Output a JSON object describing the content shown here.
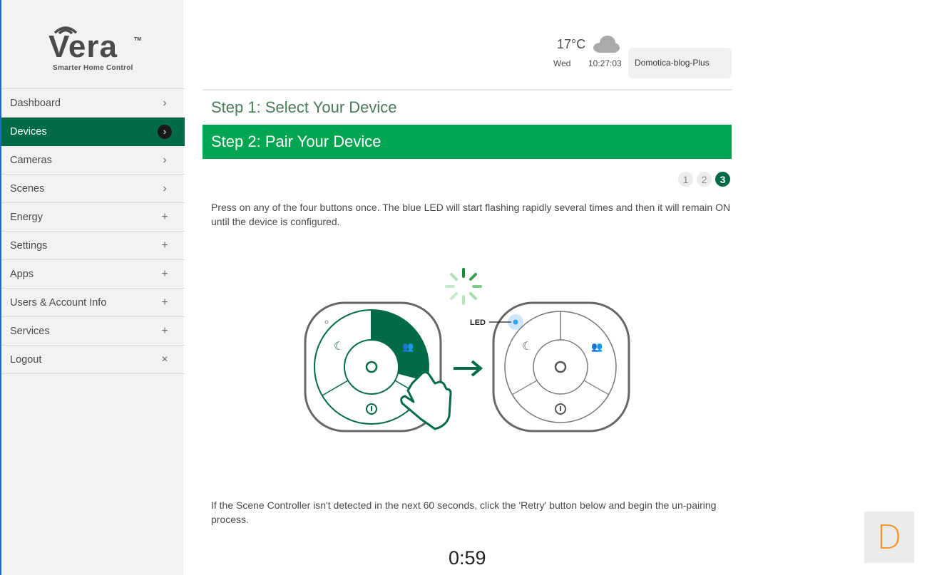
{
  "logo": {
    "word": "Vera",
    "tm": "TM",
    "subtitle": "Smarter Home Control"
  },
  "sidebar": {
    "items": [
      {
        "label": "Dashboard",
        "icon": "chevron-right-icon",
        "glyph": "›"
      },
      {
        "label": "Devices",
        "icon": "chevron-right-icon",
        "glyph": "›",
        "active": true
      },
      {
        "label": "Cameras",
        "icon": "chevron-right-icon",
        "glyph": "›"
      },
      {
        "label": "Scenes",
        "icon": "chevron-right-icon",
        "glyph": "›"
      },
      {
        "label": "Energy",
        "icon": "plus-icon",
        "glyph": "+"
      },
      {
        "label": "Settings",
        "icon": "plus-icon",
        "glyph": "+"
      },
      {
        "label": "Apps",
        "icon": "plus-icon",
        "glyph": "+"
      },
      {
        "label": "Users & Account Info",
        "icon": "plus-icon",
        "glyph": "+"
      },
      {
        "label": "Services",
        "icon": "plus-icon",
        "glyph": "+"
      },
      {
        "label": "Logout",
        "icon": "close-icon",
        "glyph": "×"
      }
    ]
  },
  "header": {
    "temperature": "17°C",
    "weather_icon": "cloud-icon",
    "day": "Wed",
    "time": "10:27:03",
    "account_name": "Domotica-blog-Plus"
  },
  "wizard": {
    "step1_title": "Step 1: Select Your Device",
    "step2_title": "Step 2: Pair Your Device",
    "pages": [
      "1",
      "2",
      "3"
    ],
    "active_page": "3",
    "instruction": "Press on any of the four buttons once. The blue LED will start flashing rapidly several times and then it will remain ON until the device is configured.",
    "led_label": "LED",
    "retry_instruction": "If the Scene Controller isn't detected in the next 60 seconds, click the 'Retry' button below and begin the un-pairing process.",
    "countdown": "0:59"
  },
  "badge": {
    "letter": "D"
  },
  "colors": {
    "active_green": "#006b45",
    "step_bar_green": "#00a551",
    "badge_orange": "#f39322",
    "led_blue": "#3aa0e6"
  }
}
